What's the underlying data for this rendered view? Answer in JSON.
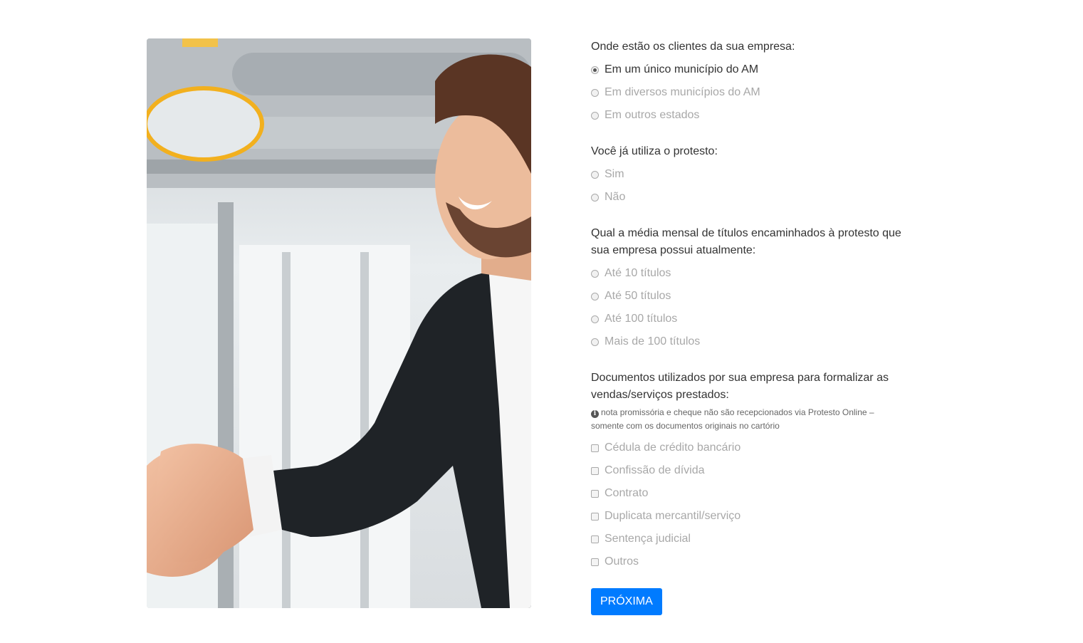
{
  "questions": [
    {
      "text": "Onde estão os clientes da sua empresa:",
      "options": [
        "Em um único município do AM",
        "Em diversos municípios do AM",
        "Em outros estados"
      ],
      "selected": "Em um único município do AM"
    },
    {
      "text": "Você já utiliza o protesto:",
      "options": [
        "Sim",
        "Não"
      ]
    },
    {
      "text": "Qual a média mensal de títulos encaminhados à protesto que sua empresa possui atualmente:",
      "options": [
        "Até 10 títulos",
        "Até 50 títulos",
        "Até 100 títulos",
        "Mais de 100 títulos"
      ]
    },
    {
      "text": "Documentos utilizados por sua empresa para formalizar as vendas/serviços prestados:",
      "note": "nota promissória e cheque não são recepcionados via Protesto Online – somente com os documentos originais no cartório",
      "options": [
        "Cédula de crédito bancário",
        "Confissão de dívida",
        "Contrato",
        "Duplicata mercantil/serviço",
        "Sentença judicial",
        "Outros"
      ]
    }
  ],
  "next_button": "PRÓXIMA",
  "info_icon_glyph": "i",
  "colors": {
    "accent": "#007bff",
    "muted_text": "#a8a8a8",
    "text": "#333333"
  },
  "icons": [
    "info-icon"
  ]
}
